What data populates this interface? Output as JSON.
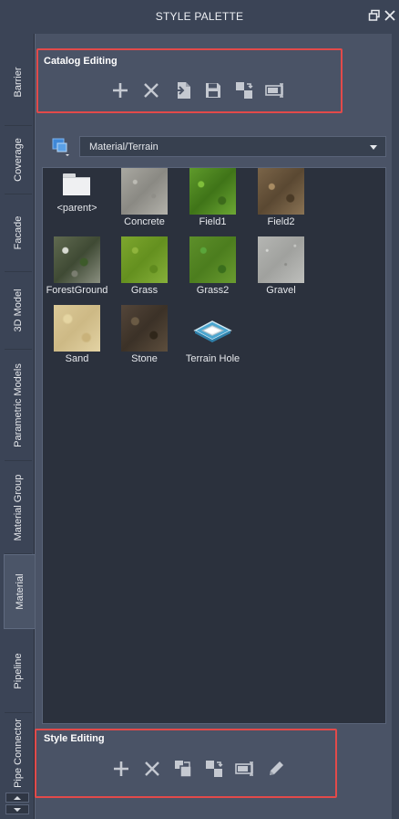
{
  "window": {
    "title": "STYLE PALETTE"
  },
  "tabs": [
    {
      "label": "Barrier",
      "active": false
    },
    {
      "label": "Coverage",
      "active": false
    },
    {
      "label": "Facade",
      "active": false
    },
    {
      "label": "3D Model",
      "active": false
    },
    {
      "label": "Parametric Models",
      "active": false
    },
    {
      "label": "Material Group",
      "active": false
    },
    {
      "label": "Material",
      "active": true
    },
    {
      "label": "Pipeline",
      "active": false
    },
    {
      "label": "Pipe Connector",
      "active": false
    }
  ],
  "catalog_editing": {
    "title": "Catalog Editing",
    "tools": [
      "add-icon",
      "delete-icon",
      "import-icon",
      "save-icon",
      "copy-to-icon",
      "rename-icon"
    ]
  },
  "catalog": {
    "selected": "Material/Terrain"
  },
  "items": [
    {
      "label": "<parent>",
      "kind": "folder"
    },
    {
      "label": "Concrete",
      "kind": "concrete"
    },
    {
      "label": "Field1",
      "kind": "field1"
    },
    {
      "label": "Field2",
      "kind": "field2"
    },
    {
      "label": "ForestGround",
      "kind": "forest"
    },
    {
      "label": "Grass",
      "kind": "grass"
    },
    {
      "label": "Grass2",
      "kind": "grass2"
    },
    {
      "label": "Gravel",
      "kind": "gravel"
    },
    {
      "label": "Sand",
      "kind": "sand"
    },
    {
      "label": "Stone",
      "kind": "stone"
    },
    {
      "label": "Terrain Hole",
      "kind": "terrain-hole"
    }
  ],
  "style_editing": {
    "title": "Style Editing",
    "tools": [
      "add-icon",
      "delete-icon",
      "copy-icon",
      "copy-to-icon",
      "rename-icon",
      "edit-pencil-icon"
    ]
  },
  "colors": {
    "highlight_border": "#e24a4a",
    "panel_bg": "#4a5366",
    "grid_bg": "#2b313d"
  }
}
